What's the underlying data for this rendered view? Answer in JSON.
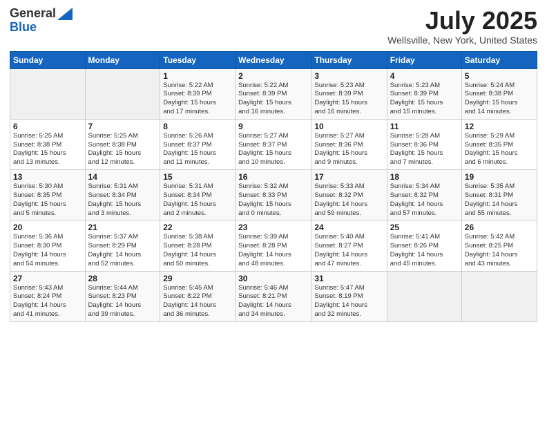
{
  "header": {
    "logo_line1": "General",
    "logo_line2": "Blue",
    "month": "July 2025",
    "location": "Wellsville, New York, United States"
  },
  "weekdays": [
    "Sunday",
    "Monday",
    "Tuesday",
    "Wednesday",
    "Thursday",
    "Friday",
    "Saturday"
  ],
  "weeks": [
    [
      {
        "day": "",
        "detail": ""
      },
      {
        "day": "",
        "detail": ""
      },
      {
        "day": "1",
        "detail": "Sunrise: 5:22 AM\nSunset: 8:39 PM\nDaylight: 15 hours\nand 17 minutes."
      },
      {
        "day": "2",
        "detail": "Sunrise: 5:22 AM\nSunset: 8:39 PM\nDaylight: 15 hours\nand 16 minutes."
      },
      {
        "day": "3",
        "detail": "Sunrise: 5:23 AM\nSunset: 8:39 PM\nDaylight: 15 hours\nand 16 minutes."
      },
      {
        "day": "4",
        "detail": "Sunrise: 5:23 AM\nSunset: 8:39 PM\nDaylight: 15 hours\nand 15 minutes."
      },
      {
        "day": "5",
        "detail": "Sunrise: 5:24 AM\nSunset: 8:38 PM\nDaylight: 15 hours\nand 14 minutes."
      }
    ],
    [
      {
        "day": "6",
        "detail": "Sunrise: 5:25 AM\nSunset: 8:38 PM\nDaylight: 15 hours\nand 13 minutes."
      },
      {
        "day": "7",
        "detail": "Sunrise: 5:25 AM\nSunset: 8:38 PM\nDaylight: 15 hours\nand 12 minutes."
      },
      {
        "day": "8",
        "detail": "Sunrise: 5:26 AM\nSunset: 8:37 PM\nDaylight: 15 hours\nand 11 minutes."
      },
      {
        "day": "9",
        "detail": "Sunrise: 5:27 AM\nSunset: 8:37 PM\nDaylight: 15 hours\nand 10 minutes."
      },
      {
        "day": "10",
        "detail": "Sunrise: 5:27 AM\nSunset: 8:36 PM\nDaylight: 15 hours\nand 9 minutes."
      },
      {
        "day": "11",
        "detail": "Sunrise: 5:28 AM\nSunset: 8:36 PM\nDaylight: 15 hours\nand 7 minutes."
      },
      {
        "day": "12",
        "detail": "Sunrise: 5:29 AM\nSunset: 8:35 PM\nDaylight: 15 hours\nand 6 minutes."
      }
    ],
    [
      {
        "day": "13",
        "detail": "Sunrise: 5:30 AM\nSunset: 8:35 PM\nDaylight: 15 hours\nand 5 minutes."
      },
      {
        "day": "14",
        "detail": "Sunrise: 5:31 AM\nSunset: 8:34 PM\nDaylight: 15 hours\nand 3 minutes."
      },
      {
        "day": "15",
        "detail": "Sunrise: 5:31 AM\nSunset: 8:34 PM\nDaylight: 15 hours\nand 2 minutes."
      },
      {
        "day": "16",
        "detail": "Sunrise: 5:32 AM\nSunset: 8:33 PM\nDaylight: 15 hours\nand 0 minutes."
      },
      {
        "day": "17",
        "detail": "Sunrise: 5:33 AM\nSunset: 8:32 PM\nDaylight: 14 hours\nand 59 minutes."
      },
      {
        "day": "18",
        "detail": "Sunrise: 5:34 AM\nSunset: 8:32 PM\nDaylight: 14 hours\nand 57 minutes."
      },
      {
        "day": "19",
        "detail": "Sunrise: 5:35 AM\nSunset: 8:31 PM\nDaylight: 14 hours\nand 55 minutes."
      }
    ],
    [
      {
        "day": "20",
        "detail": "Sunrise: 5:36 AM\nSunset: 8:30 PM\nDaylight: 14 hours\nand 54 minutes."
      },
      {
        "day": "21",
        "detail": "Sunrise: 5:37 AM\nSunset: 8:29 PM\nDaylight: 14 hours\nand 52 minutes."
      },
      {
        "day": "22",
        "detail": "Sunrise: 5:38 AM\nSunset: 8:28 PM\nDaylight: 14 hours\nand 50 minutes."
      },
      {
        "day": "23",
        "detail": "Sunrise: 5:39 AM\nSunset: 8:28 PM\nDaylight: 14 hours\nand 48 minutes."
      },
      {
        "day": "24",
        "detail": "Sunrise: 5:40 AM\nSunset: 8:27 PM\nDaylight: 14 hours\nand 47 minutes."
      },
      {
        "day": "25",
        "detail": "Sunrise: 5:41 AM\nSunset: 8:26 PM\nDaylight: 14 hours\nand 45 minutes."
      },
      {
        "day": "26",
        "detail": "Sunrise: 5:42 AM\nSunset: 8:25 PM\nDaylight: 14 hours\nand 43 minutes."
      }
    ],
    [
      {
        "day": "27",
        "detail": "Sunrise: 5:43 AM\nSunset: 8:24 PM\nDaylight: 14 hours\nand 41 minutes."
      },
      {
        "day": "28",
        "detail": "Sunrise: 5:44 AM\nSunset: 8:23 PM\nDaylight: 14 hours\nand 39 minutes."
      },
      {
        "day": "29",
        "detail": "Sunrise: 5:45 AM\nSunset: 8:22 PM\nDaylight: 14 hours\nand 36 minutes."
      },
      {
        "day": "30",
        "detail": "Sunrise: 5:46 AM\nSunset: 8:21 PM\nDaylight: 14 hours\nand 34 minutes."
      },
      {
        "day": "31",
        "detail": "Sunrise: 5:47 AM\nSunset: 8:19 PM\nDaylight: 14 hours\nand 32 minutes."
      },
      {
        "day": "",
        "detail": ""
      },
      {
        "day": "",
        "detail": ""
      }
    ]
  ]
}
